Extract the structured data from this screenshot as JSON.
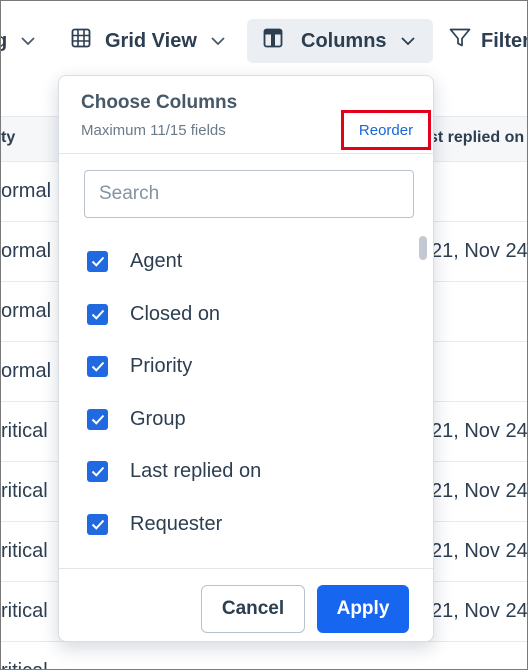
{
  "toolbar": {
    "sort_label": "g",
    "grid_view_label": "Grid View",
    "columns_label": "Columns",
    "filter_label": "Filter"
  },
  "table": {
    "headers": {
      "left": "ty",
      "right": "st replied on"
    },
    "rows": [
      {
        "left": "ormal",
        "right": ""
      },
      {
        "left": "ormal",
        "right": "21, Nov 24"
      },
      {
        "left": "ormal",
        "right": ""
      },
      {
        "left": "ormal",
        "right": ""
      },
      {
        "left": "ritical",
        "right": "21, Nov 24"
      },
      {
        "left": "ritical",
        "right": "21, Nov 24"
      },
      {
        "left": "ritical",
        "right": "21, Nov 24"
      },
      {
        "left": "ritical",
        "right": "21, Nov 24"
      },
      {
        "left": "ritical",
        "right": ""
      }
    ]
  },
  "popover": {
    "title": "Choose Columns",
    "subtitle": "Maximum 11/15 fields",
    "reorder_label": "Reorder",
    "search_placeholder": "Search",
    "search_value": "",
    "items": [
      {
        "label": "Agent",
        "checked": true
      },
      {
        "label": "Closed on",
        "checked": true
      },
      {
        "label": "Priority",
        "checked": true
      },
      {
        "label": "Group",
        "checked": true
      },
      {
        "label": "Last replied on",
        "checked": true
      },
      {
        "label": "Requester",
        "checked": true
      }
    ],
    "cancel_label": "Cancel",
    "apply_label": "Apply"
  },
  "colors": {
    "accent": "#1766f0",
    "checkbox": "#2169e0",
    "highlight_box": "#e3001b",
    "link": "#1766db"
  }
}
